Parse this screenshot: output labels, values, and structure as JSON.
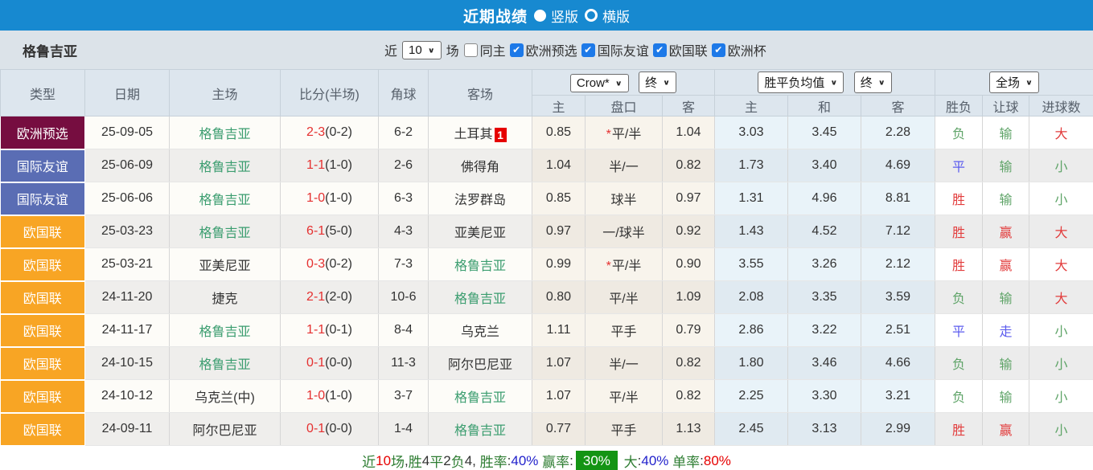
{
  "colors": {
    "topbar_blue": "#1789d0",
    "type_euro_qualifier": "#760d40",
    "type_friendly": "#5a6db4",
    "type_nations_league": "#f8a524",
    "team_highlight_green": "#3b9d6f",
    "win_red": "#e23c3c",
    "draw_blue": "#5b5bee",
    "lose_green": "#5fa468",
    "score_red": "#e53030",
    "badge_red": "#e60000",
    "rate_badge_green": "#149414"
  },
  "topbar": {
    "title": "近期战绩",
    "radios": [
      {
        "label": "竖版",
        "selected": true
      },
      {
        "label": "横版",
        "selected": false
      }
    ]
  },
  "filterbar": {
    "team": "格鲁吉亚",
    "near_label": "近",
    "count_value": "10",
    "games_label": "场",
    "checkboxes": [
      {
        "label": "同主",
        "checked": false
      },
      {
        "label": "欧洲预选",
        "checked": true
      },
      {
        "label": "国际友谊",
        "checked": true
      },
      {
        "label": "欧国联",
        "checked": true
      },
      {
        "label": "欧洲杯",
        "checked": true
      }
    ]
  },
  "table": {
    "main_headers": [
      "类型",
      "日期",
      "主场",
      "比分(半场)",
      "角球",
      "客场"
    ],
    "group_selects": {
      "odds_company": "Crow*",
      "odds_time": "终",
      "mean_label": "胜平负均值",
      "mean_time": "终",
      "scope": "全场"
    },
    "sub_headers": [
      "主",
      "盘口",
      "客",
      "主",
      "和",
      "客",
      "胜负",
      "让球",
      "进球数"
    ],
    "rows": [
      {
        "type": "欧洲预选",
        "type_color": "purple",
        "date": "25-09-05",
        "home": "格鲁吉亚",
        "home_hl": true,
        "score_ft": "2-3",
        "score_ht": "(0-2)",
        "corners": "6-2",
        "away": "土耳其",
        "away_hl": false,
        "away_badge": "1",
        "odds_home": "0.85",
        "handicap": "平/半",
        "handicap_star": true,
        "odds_away": "1.04",
        "mean_win": "3.03",
        "mean_draw": "3.45",
        "mean_lose": "2.28",
        "res_wdl": "负",
        "res_wdl_c": "g",
        "res_handicap": "输",
        "res_handicap_c": "g",
        "res_goal": "大",
        "res_goal_c": "r"
      },
      {
        "type": "国际友谊",
        "type_color": "blue",
        "date": "25-06-09",
        "home": "格鲁吉亚",
        "home_hl": true,
        "score_ft": "1-1",
        "score_ht": "(1-0)",
        "corners": "2-6",
        "away": "佛得角",
        "away_hl": false,
        "away_badge": "",
        "odds_home": "1.04",
        "handicap": "半/一",
        "handicap_star": false,
        "odds_away": "0.82",
        "mean_win": "1.73",
        "mean_draw": "3.40",
        "mean_lose": "4.69",
        "res_wdl": "平",
        "res_wdl_c": "b",
        "res_handicap": "输",
        "res_handicap_c": "g",
        "res_goal": "小",
        "res_goal_c": "g"
      },
      {
        "type": "国际友谊",
        "type_color": "blue",
        "date": "25-06-06",
        "home": "格鲁吉亚",
        "home_hl": true,
        "score_ft": "1-0",
        "score_ht": "(1-0)",
        "corners": "6-3",
        "away": "法罗群岛",
        "away_hl": false,
        "away_badge": "",
        "odds_home": "0.85",
        "handicap": "球半",
        "handicap_star": false,
        "odds_away": "0.97",
        "mean_win": "1.31",
        "mean_draw": "4.96",
        "mean_lose": "8.81",
        "res_wdl": "胜",
        "res_wdl_c": "r",
        "res_handicap": "输",
        "res_handicap_c": "g",
        "res_goal": "小",
        "res_goal_c": "g"
      },
      {
        "type": "欧国联",
        "type_color": "orange",
        "date": "25-03-23",
        "home": "格鲁吉亚",
        "home_hl": true,
        "score_ft": "6-1",
        "score_ht": "(5-0)",
        "corners": "4-3",
        "away": "亚美尼亚",
        "away_hl": false,
        "away_badge": "",
        "odds_home": "0.97",
        "handicap": "一/球半",
        "handicap_star": false,
        "odds_away": "0.92",
        "mean_win": "1.43",
        "mean_draw": "4.52",
        "mean_lose": "7.12",
        "res_wdl": "胜",
        "res_wdl_c": "r",
        "res_handicap": "赢",
        "res_handicap_c": "r",
        "res_goal": "大",
        "res_goal_c": "r"
      },
      {
        "type": "欧国联",
        "type_color": "orange",
        "date": "25-03-21",
        "home": "亚美尼亚",
        "home_hl": false,
        "score_ft": "0-3",
        "score_ht": "(0-2)",
        "corners": "7-3",
        "away": "格鲁吉亚",
        "away_hl": true,
        "away_badge": "",
        "odds_home": "0.99",
        "handicap": "平/半",
        "handicap_star": true,
        "odds_away": "0.90",
        "mean_win": "3.55",
        "mean_draw": "3.26",
        "mean_lose": "2.12",
        "res_wdl": "胜",
        "res_wdl_c": "r",
        "res_handicap": "赢",
        "res_handicap_c": "r",
        "res_goal": "大",
        "res_goal_c": "r"
      },
      {
        "type": "欧国联",
        "type_color": "orange",
        "date": "24-11-20",
        "home": "捷克",
        "home_hl": false,
        "score_ft": "2-1",
        "score_ht": "(2-0)",
        "corners": "10-6",
        "away": "格鲁吉亚",
        "away_hl": true,
        "away_badge": "",
        "odds_home": "0.80",
        "handicap": "平/半",
        "handicap_star": false,
        "odds_away": "1.09",
        "mean_win": "2.08",
        "mean_draw": "3.35",
        "mean_lose": "3.59",
        "res_wdl": "负",
        "res_wdl_c": "g",
        "res_handicap": "输",
        "res_handicap_c": "g",
        "res_goal": "大",
        "res_goal_c": "r"
      },
      {
        "type": "欧国联",
        "type_color": "orange",
        "date": "24-11-17",
        "home": "格鲁吉亚",
        "home_hl": true,
        "score_ft": "1-1",
        "score_ht": "(0-1)",
        "corners": "8-4",
        "away": "乌克兰",
        "away_hl": false,
        "away_badge": "",
        "odds_home": "1.11",
        "handicap": "平手",
        "handicap_star": false,
        "odds_away": "0.79",
        "mean_win": "2.86",
        "mean_draw": "3.22",
        "mean_lose": "2.51",
        "res_wdl": "平",
        "res_wdl_c": "b",
        "res_handicap": "走",
        "res_handicap_c": "b",
        "res_goal": "小",
        "res_goal_c": "g"
      },
      {
        "type": "欧国联",
        "type_color": "orange",
        "date": "24-10-15",
        "home": "格鲁吉亚",
        "home_hl": true,
        "score_ft": "0-1",
        "score_ht": "(0-0)",
        "corners": "11-3",
        "away": "阿尔巴尼亚",
        "away_hl": false,
        "away_badge": "",
        "odds_home": "1.07",
        "handicap": "半/一",
        "handicap_star": false,
        "odds_away": "0.82",
        "mean_win": "1.80",
        "mean_draw": "3.46",
        "mean_lose": "4.66",
        "res_wdl": "负",
        "res_wdl_c": "g",
        "res_handicap": "输",
        "res_handicap_c": "g",
        "res_goal": "小",
        "res_goal_c": "g"
      },
      {
        "type": "欧国联",
        "type_color": "orange",
        "date": "24-10-12",
        "home": "乌克兰(中)",
        "home_hl": false,
        "score_ft": "1-0",
        "score_ht": "(1-0)",
        "corners": "3-7",
        "away": "格鲁吉亚",
        "away_hl": true,
        "away_badge": "",
        "odds_home": "1.07",
        "handicap": "平/半",
        "handicap_star": false,
        "odds_away": "0.82",
        "mean_win": "2.25",
        "mean_draw": "3.30",
        "mean_lose": "3.21",
        "res_wdl": "负",
        "res_wdl_c": "g",
        "res_handicap": "输",
        "res_handicap_c": "g",
        "res_goal": "小",
        "res_goal_c": "g"
      },
      {
        "type": "欧国联",
        "type_color": "orange",
        "date": "24-09-11",
        "home": "阿尔巴尼亚",
        "home_hl": false,
        "score_ft": "0-1",
        "score_ht": "(0-0)",
        "corners": "1-4",
        "away": "格鲁吉亚",
        "away_hl": true,
        "away_badge": "",
        "odds_home": "0.77",
        "handicap": "平手",
        "handicap_star": false,
        "odds_away": "1.13",
        "mean_win": "2.45",
        "mean_draw": "3.13",
        "mean_lose": "2.99",
        "res_wdl": "胜",
        "res_wdl_c": "r",
        "res_handicap": "赢",
        "res_handicap_c": "r",
        "res_goal": "小",
        "res_goal_c": "g"
      }
    ]
  },
  "summary": {
    "segments": [
      {
        "text": "近",
        "style": "g"
      },
      {
        "text": "10",
        "style": "r"
      },
      {
        "text": "场",
        "style": "g"
      },
      {
        "text": ",",
        "style": "d"
      },
      {
        "text": "胜",
        "style": "g"
      },
      {
        "text": "4",
        "style": "d"
      },
      {
        "text": "平",
        "style": "g"
      },
      {
        "text": "2",
        "style": "d"
      },
      {
        "text": "负",
        "style": "g"
      },
      {
        "text": "4",
        "style": "d"
      },
      {
        "text": ", ",
        "style": "d"
      },
      {
        "text": "胜率",
        "style": "g"
      },
      {
        "text": ":",
        "style": "d"
      },
      {
        "text": "40%",
        "style": "b"
      },
      {
        "text": " ",
        "style": "d"
      },
      {
        "text": "赢率",
        "style": "g"
      },
      {
        "text": ":",
        "style": "d"
      },
      {
        "text": "30%",
        "style": "gb"
      },
      {
        "text": " ",
        "style": "d"
      },
      {
        "text": "大",
        "style": "g"
      },
      {
        "text": ":",
        "style": "d"
      },
      {
        "text": "40%",
        "style": "b"
      },
      {
        "text": " ",
        "style": "d"
      },
      {
        "text": "单率",
        "style": "g"
      },
      {
        "text": ":",
        "style": "d"
      },
      {
        "text": "80%",
        "style": "r"
      }
    ]
  }
}
